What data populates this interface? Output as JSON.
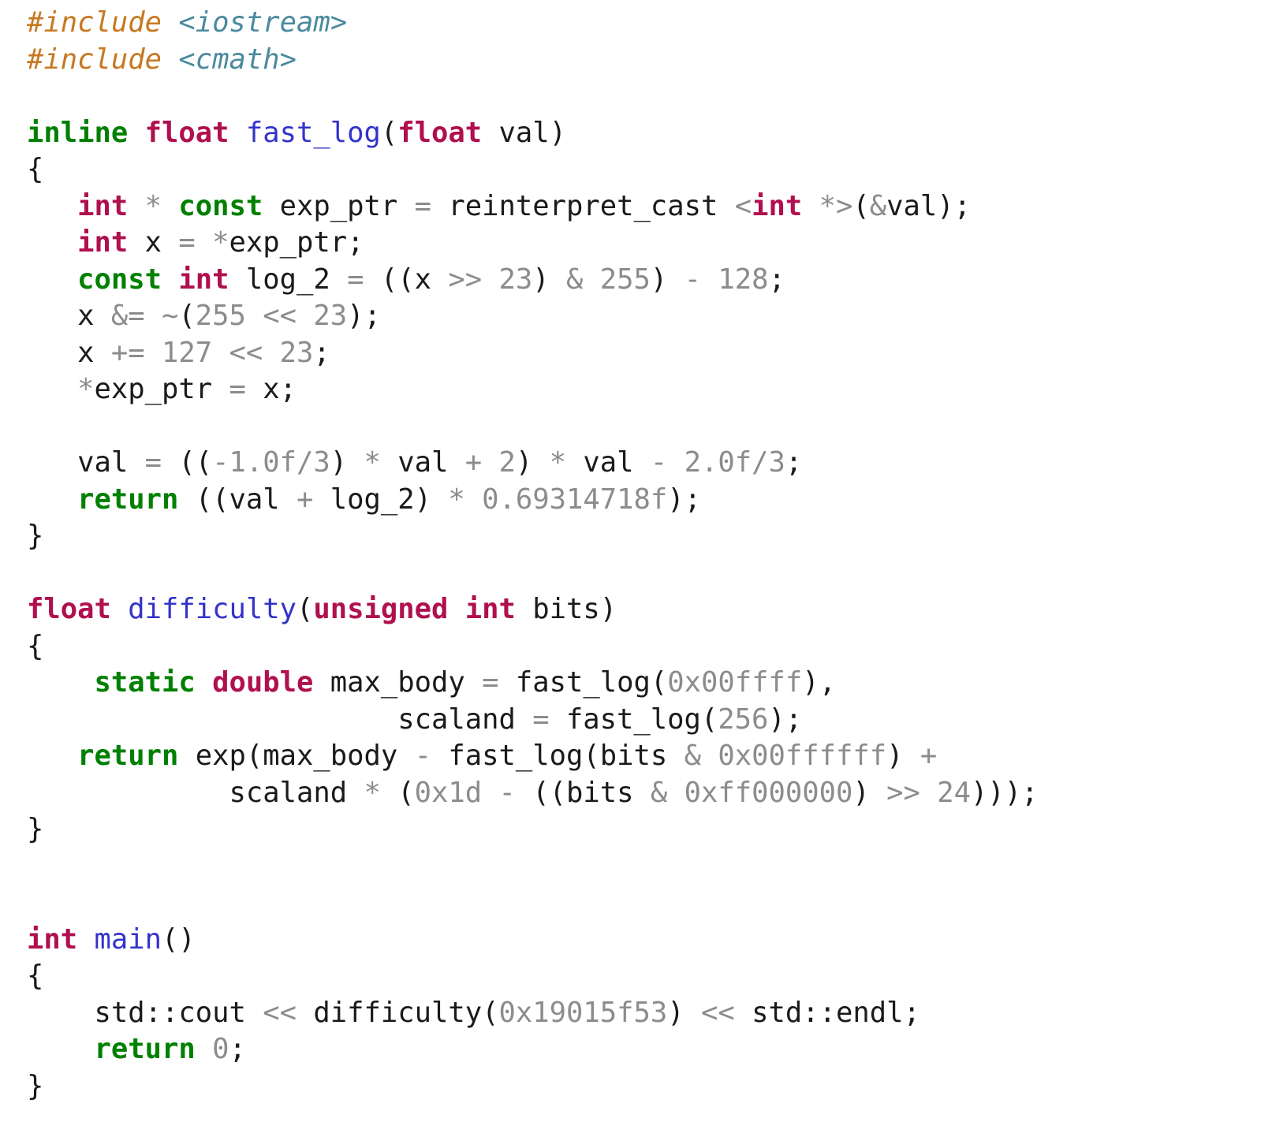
{
  "document": {
    "kind": "source-code-listing",
    "language": "C++",
    "background_color": "#ffffff",
    "font_size_px": 35.5,
    "line_height_px": 46.5
  },
  "theme": {
    "preprocessor_color": "#c87820",
    "include_header_color": "#4a8a9e",
    "keyword_color": "#008000",
    "type_color": "#b0104f",
    "function_color": "#3333cc",
    "number_color": "#8c8c8c",
    "operator_color": "#8c8c8c",
    "identifier_color": "#1a1a1a",
    "punctuation_color": "#1a1a1a"
  },
  "code": {
    "plain_text": "#include <iostream>\n#include <cmath>\n\ninline float fast_log(float val)\n{\n   int * const exp_ptr = reinterpret_cast <int *>(&val);\n   int x = *exp_ptr;\n   const int log_2 = ((x >> 23) & 255) - 128;\n   x &= ~(255 << 23);\n   x += 127 << 23;\n   *exp_ptr = x;\n\n   val = ((-1.0f/3) * val + 2) * val - 2.0f/3;\n   return ((val + log_2) * 0.69314718f);\n}\n\nfloat difficulty(unsigned int bits)\n{\n    static double max_body = fast_log(0x00ffff),\n                      scaland = fast_log(256);\n    return exp(max_body - fast_log(bits & 0x00ffffff) +\n            scaland * (0x1d - ((bits & 0xff000000) >> 24)));\n}\n\nint main()\n{\n    std::cout << difficulty(0x19015f53) << std::endl;\n    return 0;\n}",
    "lines": [
      {
        "n": 1,
        "tokens": [
          {
            "t": "pre",
            "v": "#include"
          },
          {
            "t": "id",
            "v": " "
          },
          {
            "t": "inc",
            "v": "<iostream>"
          }
        ]
      },
      {
        "n": 2,
        "tokens": [
          {
            "t": "pre",
            "v": "#include"
          },
          {
            "t": "id",
            "v": " "
          },
          {
            "t": "inc",
            "v": "<cmath>"
          }
        ]
      },
      {
        "n": 3,
        "tokens": []
      },
      {
        "n": 4,
        "tokens": [
          {
            "t": "kw",
            "v": "inline"
          },
          {
            "t": "id",
            "v": " "
          },
          {
            "t": "type",
            "v": "float"
          },
          {
            "t": "id",
            "v": " "
          },
          {
            "t": "fn",
            "v": "fast_log"
          },
          {
            "t": "punct",
            "v": "("
          },
          {
            "t": "type",
            "v": "float"
          },
          {
            "t": "id",
            "v": " val"
          },
          {
            "t": "punct",
            "v": ")"
          }
        ]
      },
      {
        "n": 5,
        "tokens": [
          {
            "t": "punct",
            "v": "{"
          }
        ]
      },
      {
        "n": 6,
        "tokens": [
          {
            "t": "id",
            "v": "   "
          },
          {
            "t": "type",
            "v": "int"
          },
          {
            "t": "id",
            "v": " "
          },
          {
            "t": "op",
            "v": "*"
          },
          {
            "t": "id",
            "v": " "
          },
          {
            "t": "kw",
            "v": "const"
          },
          {
            "t": "id",
            "v": " exp_ptr "
          },
          {
            "t": "op",
            "v": "="
          },
          {
            "t": "id",
            "v": " reinterpret_cast "
          },
          {
            "t": "op",
            "v": "<"
          },
          {
            "t": "type",
            "v": "int"
          },
          {
            "t": "id",
            "v": " "
          },
          {
            "t": "op",
            "v": "*>"
          },
          {
            "t": "punct",
            "v": "("
          },
          {
            "t": "op",
            "v": "&"
          },
          {
            "t": "id",
            "v": "val"
          },
          {
            "t": "punct",
            "v": ");"
          }
        ]
      },
      {
        "n": 7,
        "tokens": [
          {
            "t": "id",
            "v": "   "
          },
          {
            "t": "type",
            "v": "int"
          },
          {
            "t": "id",
            "v": " x "
          },
          {
            "t": "op",
            "v": "="
          },
          {
            "t": "id",
            "v": " "
          },
          {
            "t": "op",
            "v": "*"
          },
          {
            "t": "id",
            "v": "exp_ptr"
          },
          {
            "t": "punct",
            "v": ";"
          }
        ]
      },
      {
        "n": 8,
        "tokens": [
          {
            "t": "id",
            "v": "   "
          },
          {
            "t": "kw",
            "v": "const"
          },
          {
            "t": "id",
            "v": " "
          },
          {
            "t": "type",
            "v": "int"
          },
          {
            "t": "id",
            "v": " log_2 "
          },
          {
            "t": "op",
            "v": "="
          },
          {
            "t": "id",
            "v": " "
          },
          {
            "t": "punct",
            "v": "(("
          },
          {
            "t": "id",
            "v": "x "
          },
          {
            "t": "op",
            "v": ">>"
          },
          {
            "t": "id",
            "v": " "
          },
          {
            "t": "num",
            "v": "23"
          },
          {
            "t": "punct",
            "v": ")"
          },
          {
            "t": "id",
            "v": " "
          },
          {
            "t": "op",
            "v": "&"
          },
          {
            "t": "id",
            "v": " "
          },
          {
            "t": "num",
            "v": "255"
          },
          {
            "t": "punct",
            "v": ")"
          },
          {
            "t": "id",
            "v": " "
          },
          {
            "t": "op",
            "v": "-"
          },
          {
            "t": "id",
            "v": " "
          },
          {
            "t": "num",
            "v": "128"
          },
          {
            "t": "punct",
            "v": ";"
          }
        ]
      },
      {
        "n": 9,
        "tokens": [
          {
            "t": "id",
            "v": "   x "
          },
          {
            "t": "op",
            "v": "&="
          },
          {
            "t": "id",
            "v": " "
          },
          {
            "t": "op",
            "v": "~"
          },
          {
            "t": "punct",
            "v": "("
          },
          {
            "t": "num",
            "v": "255"
          },
          {
            "t": "id",
            "v": " "
          },
          {
            "t": "op",
            "v": "<<"
          },
          {
            "t": "id",
            "v": " "
          },
          {
            "t": "num",
            "v": "23"
          },
          {
            "t": "punct",
            "v": ");"
          }
        ]
      },
      {
        "n": 10,
        "tokens": [
          {
            "t": "id",
            "v": "   x "
          },
          {
            "t": "op",
            "v": "+="
          },
          {
            "t": "id",
            "v": " "
          },
          {
            "t": "num",
            "v": "127"
          },
          {
            "t": "id",
            "v": " "
          },
          {
            "t": "op",
            "v": "<<"
          },
          {
            "t": "id",
            "v": " "
          },
          {
            "t": "num",
            "v": "23"
          },
          {
            "t": "punct",
            "v": ";"
          }
        ]
      },
      {
        "n": 11,
        "tokens": [
          {
            "t": "id",
            "v": "   "
          },
          {
            "t": "op",
            "v": "*"
          },
          {
            "t": "id",
            "v": "exp_ptr "
          },
          {
            "t": "op",
            "v": "="
          },
          {
            "t": "id",
            "v": " x"
          },
          {
            "t": "punct",
            "v": ";"
          }
        ]
      },
      {
        "n": 12,
        "tokens": []
      },
      {
        "n": 13,
        "tokens": [
          {
            "t": "id",
            "v": "   val "
          },
          {
            "t": "op",
            "v": "="
          },
          {
            "t": "id",
            "v": " "
          },
          {
            "t": "punct",
            "v": "(("
          },
          {
            "t": "op",
            "v": "-"
          },
          {
            "t": "num",
            "v": "1.0f"
          },
          {
            "t": "op",
            "v": "/"
          },
          {
            "t": "num",
            "v": "3"
          },
          {
            "t": "punct",
            "v": ")"
          },
          {
            "t": "id",
            "v": " "
          },
          {
            "t": "op",
            "v": "*"
          },
          {
            "t": "id",
            "v": " val "
          },
          {
            "t": "op",
            "v": "+"
          },
          {
            "t": "id",
            "v": " "
          },
          {
            "t": "num",
            "v": "2"
          },
          {
            "t": "punct",
            "v": ")"
          },
          {
            "t": "id",
            "v": " "
          },
          {
            "t": "op",
            "v": "*"
          },
          {
            "t": "id",
            "v": " val "
          },
          {
            "t": "op",
            "v": "-"
          },
          {
            "t": "id",
            "v": " "
          },
          {
            "t": "num",
            "v": "2.0f"
          },
          {
            "t": "op",
            "v": "/"
          },
          {
            "t": "num",
            "v": "3"
          },
          {
            "t": "punct",
            "v": ";"
          }
        ]
      },
      {
        "n": 14,
        "tokens": [
          {
            "t": "id",
            "v": "   "
          },
          {
            "t": "kw",
            "v": "return"
          },
          {
            "t": "id",
            "v": " "
          },
          {
            "t": "punct",
            "v": "(("
          },
          {
            "t": "id",
            "v": "val "
          },
          {
            "t": "op",
            "v": "+"
          },
          {
            "t": "id",
            "v": " log_2"
          },
          {
            "t": "punct",
            "v": ")"
          },
          {
            "t": "id",
            "v": " "
          },
          {
            "t": "op",
            "v": "*"
          },
          {
            "t": "id",
            "v": " "
          },
          {
            "t": "num",
            "v": "0.69314718f"
          },
          {
            "t": "punct",
            "v": ");"
          }
        ]
      },
      {
        "n": 15,
        "tokens": [
          {
            "t": "punct",
            "v": "}"
          }
        ]
      },
      {
        "n": 16,
        "tokens": []
      },
      {
        "n": 17,
        "tokens": [
          {
            "t": "type",
            "v": "float"
          },
          {
            "t": "id",
            "v": " "
          },
          {
            "t": "fn",
            "v": "difficulty"
          },
          {
            "t": "punct",
            "v": "("
          },
          {
            "t": "type",
            "v": "unsigned int"
          },
          {
            "t": "id",
            "v": " bits"
          },
          {
            "t": "punct",
            "v": ")"
          }
        ]
      },
      {
        "n": 18,
        "tokens": [
          {
            "t": "punct",
            "v": "{"
          }
        ]
      },
      {
        "n": 19,
        "tokens": [
          {
            "t": "id",
            "v": "    "
          },
          {
            "t": "kw",
            "v": "static"
          },
          {
            "t": "id",
            "v": " "
          },
          {
            "t": "type",
            "v": "double"
          },
          {
            "t": "id",
            "v": " max_body "
          },
          {
            "t": "op",
            "v": "="
          },
          {
            "t": "id",
            "v": " fast_log"
          },
          {
            "t": "punct",
            "v": "("
          },
          {
            "t": "num",
            "v": "0x00ffff"
          },
          {
            "t": "punct",
            "v": "),"
          }
        ]
      },
      {
        "n": 20,
        "tokens": [
          {
            "t": "id",
            "v": "                      scaland "
          },
          {
            "t": "op",
            "v": "="
          },
          {
            "t": "id",
            "v": " fast_log"
          },
          {
            "t": "punct",
            "v": "("
          },
          {
            "t": "num",
            "v": "256"
          },
          {
            "t": "punct",
            "v": ");"
          }
        ]
      },
      {
        "n": 21,
        "tokens": [
          {
            "t": "id",
            "v": "   "
          },
          {
            "t": "kw",
            "v": "return"
          },
          {
            "t": "id",
            "v": " exp"
          },
          {
            "t": "punct",
            "v": "("
          },
          {
            "t": "id",
            "v": "max_body "
          },
          {
            "t": "op",
            "v": "-"
          },
          {
            "t": "id",
            "v": " fast_log"
          },
          {
            "t": "punct",
            "v": "("
          },
          {
            "t": "id",
            "v": "bits "
          },
          {
            "t": "op",
            "v": "&"
          },
          {
            "t": "id",
            "v": " "
          },
          {
            "t": "num",
            "v": "0x00ffffff"
          },
          {
            "t": "punct",
            "v": ")"
          },
          {
            "t": "id",
            "v": " "
          },
          {
            "t": "op",
            "v": "+"
          }
        ]
      },
      {
        "n": 22,
        "tokens": [
          {
            "t": "id",
            "v": "            scaland "
          },
          {
            "t": "op",
            "v": "*"
          },
          {
            "t": "id",
            "v": " "
          },
          {
            "t": "punct",
            "v": "("
          },
          {
            "t": "num",
            "v": "0x1d"
          },
          {
            "t": "id",
            "v": " "
          },
          {
            "t": "op",
            "v": "-"
          },
          {
            "t": "id",
            "v": " "
          },
          {
            "t": "punct",
            "v": "(("
          },
          {
            "t": "id",
            "v": "bits "
          },
          {
            "t": "op",
            "v": "&"
          },
          {
            "t": "id",
            "v": " "
          },
          {
            "t": "num",
            "v": "0xff000000"
          },
          {
            "t": "punct",
            "v": ")"
          },
          {
            "t": "id",
            "v": " "
          },
          {
            "t": "op",
            "v": ">>"
          },
          {
            "t": "id",
            "v": " "
          },
          {
            "t": "num",
            "v": "24"
          },
          {
            "t": "punct",
            "v": ")));"
          }
        ]
      },
      {
        "n": 23,
        "tokens": [
          {
            "t": "punct",
            "v": "}"
          }
        ]
      },
      {
        "n": 24,
        "tokens": []
      },
      {
        "n": 25,
        "tokens": []
      },
      {
        "n": 26,
        "tokens": [
          {
            "t": "type",
            "v": "int"
          },
          {
            "t": "id",
            "v": " "
          },
          {
            "t": "fn",
            "v": "main"
          },
          {
            "t": "punct",
            "v": "()"
          }
        ]
      },
      {
        "n": 27,
        "tokens": [
          {
            "t": "punct",
            "v": "{"
          }
        ]
      },
      {
        "n": 28,
        "tokens": [
          {
            "t": "id",
            "v": "    std"
          },
          {
            "t": "punct",
            "v": "::"
          },
          {
            "t": "id",
            "v": "cout "
          },
          {
            "t": "op",
            "v": "<<"
          },
          {
            "t": "id",
            "v": " difficulty"
          },
          {
            "t": "punct",
            "v": "("
          },
          {
            "t": "num",
            "v": "0x19015f53"
          },
          {
            "t": "punct",
            "v": ")"
          },
          {
            "t": "id",
            "v": " "
          },
          {
            "t": "op",
            "v": "<<"
          },
          {
            "t": "id",
            "v": " std"
          },
          {
            "t": "punct",
            "v": "::"
          },
          {
            "t": "id",
            "v": "endl"
          },
          {
            "t": "punct",
            "v": ";"
          }
        ]
      },
      {
        "n": 29,
        "tokens": [
          {
            "t": "id",
            "v": "    "
          },
          {
            "t": "kw",
            "v": "return"
          },
          {
            "t": "id",
            "v": " "
          },
          {
            "t": "num",
            "v": "0"
          },
          {
            "t": "punct",
            "v": ";"
          }
        ]
      },
      {
        "n": 30,
        "tokens": [
          {
            "t": "punct",
            "v": "}"
          }
        ]
      }
    ]
  }
}
